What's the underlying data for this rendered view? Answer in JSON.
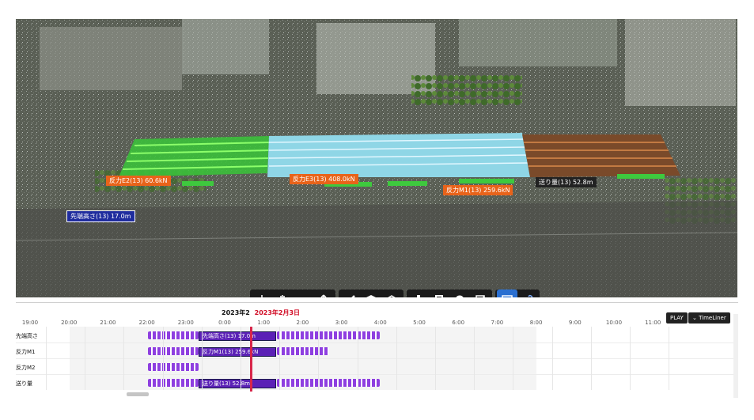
{
  "viewport": {
    "tags": [
      {
        "id": "e2",
        "text": "反力E2(13)  60.6kN",
        "color": "orange"
      },
      {
        "id": "e3",
        "text": "反力E3(13)  408.0kN",
        "color": "orange"
      },
      {
        "id": "m1",
        "text": "反力M1(13)  259.6kN",
        "color": "orange"
      },
      {
        "id": "feed",
        "text": "送り量(13)  52.8m",
        "color": "dark"
      },
      {
        "id": "height",
        "text": "先端高さ(13)  17.0m",
        "color": "blue"
      }
    ]
  },
  "toolbar": {
    "groups": [
      [
        "orbit-icon",
        "pan-icon",
        "camera-icon",
        "vertical-move-icon"
      ],
      [
        "measure-icon",
        "box-select-icon",
        "model-icon"
      ],
      [
        "hierarchy-icon",
        "save-icon",
        "settings-icon",
        "section-icon"
      ],
      [
        "calendar-icon",
        "link-icon"
      ]
    ]
  },
  "timeline": {
    "date_left": "2023年2",
    "date_current": "2023年2月3日",
    "hours": [
      "19:00",
      "20:00",
      "21:00",
      "22:00",
      "23:00",
      "0:00",
      "1:00",
      "2:00",
      "3:00",
      "4:00",
      "5:00",
      "6:00",
      "7:00",
      "8:00",
      "9:00",
      "10:00",
      "11:00"
    ],
    "play_label": "PLAY",
    "timeliner_label": "TimeLiner",
    "rows": [
      {
        "label": "先端高さ",
        "bar_label": "先端高さ(13)  17.0m"
      },
      {
        "label": "反力M1",
        "bar_label": "反力M1(13)  259.6kN"
      },
      {
        "label": "反力M2",
        "bar_label": ""
      },
      {
        "label": "送り量",
        "bar_label": "送り量(13)  52.8m"
      }
    ]
  },
  "colors": {
    "bar": "#8e3fe0",
    "bar_label": "#5b21b6",
    "cursor": "#d8264a",
    "accent": "#2a6fd1"
  }
}
